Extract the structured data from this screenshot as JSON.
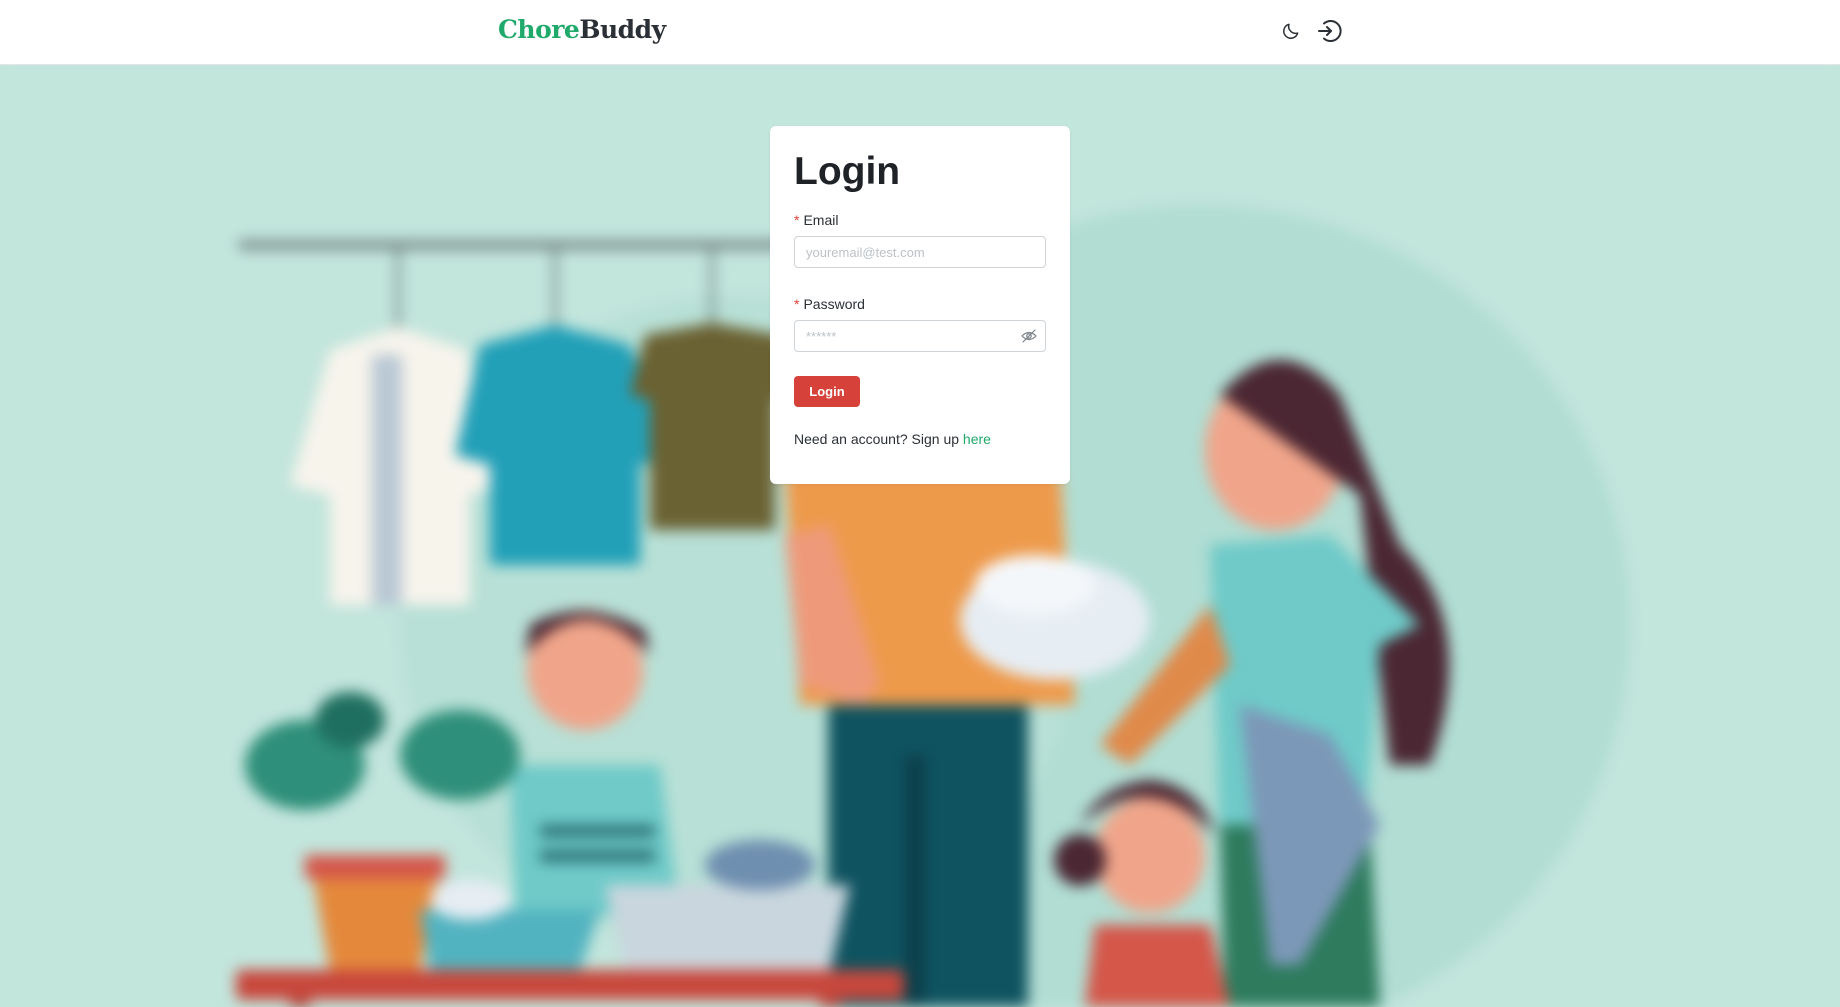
{
  "header": {
    "logo_part1": "Chore",
    "logo_part2": "Buddy",
    "theme_toggle_icon": "moon-icon",
    "login_icon": "login-icon"
  },
  "login_form": {
    "title": "Login",
    "email": {
      "label": "Email",
      "required_mark": "*",
      "value": "",
      "placeholder": "youremail@test.com"
    },
    "password": {
      "label": "Password",
      "required_mark": "*",
      "value": "",
      "placeholder": "******",
      "visibility_icon": "eye-off-icon"
    },
    "submit_label": "Login",
    "signup_prompt": "Need an account? Sign up",
    "signup_link": "here"
  },
  "background": {
    "illustration": "family-laundry-illustration"
  },
  "colors": {
    "brand_green": "#1fa96b",
    "brand_dark": "#2b3036",
    "accent_red": "#d6423a",
    "background_mint": "#c2e5dc"
  }
}
